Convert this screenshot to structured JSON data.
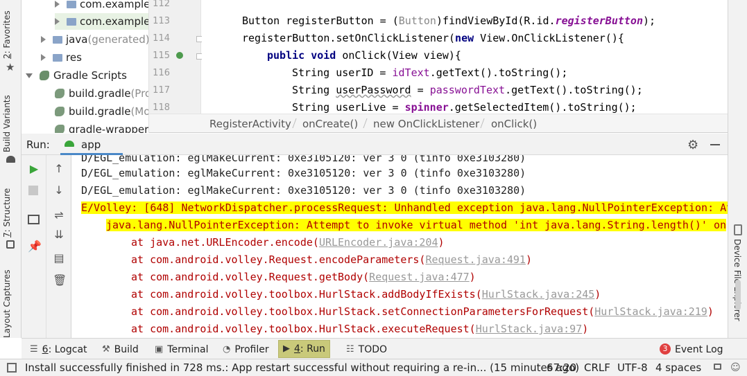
{
  "left_strip": {
    "favorites": {
      "num": "2",
      "label": ": Favorites"
    },
    "build_variants": "Build Variants",
    "structure": {
      "num": "7",
      "label": ": Structure"
    },
    "layout_captures": "Layout Captures"
  },
  "right_strip": {
    "device_explorer": "Device File Explorer"
  },
  "project_tree": [
    {
      "label": "com.example",
      "suffix": ""
    },
    {
      "label": "com.example",
      "suffix": ""
    },
    {
      "label": "java",
      "suffix": " (generated)"
    },
    {
      "label": "res",
      "suffix": ""
    },
    {
      "label": "Gradle Scripts",
      "suffix": ""
    },
    {
      "label": "build.gradle",
      "suffix": " (Pro"
    },
    {
      "label": "build.gradle",
      "suffix": " (Mo"
    },
    {
      "label": "gradle-wrapper.p",
      "suffix": ""
    }
  ],
  "editor": {
    "line_numbers": [
      "112",
      "113",
      "114",
      "115",
      "116",
      "117",
      "118"
    ],
    "lines": {
      "l113a": "Button registerButton = (",
      "l113b": "Button",
      "l113c": ")findViewById(R.id.",
      "l113d": "registerButton",
      "l113e": ");",
      "l114a": "registerButton.setOnClickListener(",
      "l114b": "new",
      "l114c": " View.OnClickListener(){",
      "l115a": "public",
      "l115b": " ",
      "l115c": "void",
      "l115d": " onClick(View view){",
      "l116a": "String userID = ",
      "l116b": "idText",
      "l116c": ".getText().toString();",
      "l117a": "String ",
      "l117b": "userPassword",
      "l117c": " = ",
      "l117d": "passwordText",
      "l117e": ".getText().toString();",
      "l118a": "String userLive = ",
      "l118b": "spinner",
      "l118c": ".getSelectedItem().toString();"
    }
  },
  "breadcrumb": [
    "RegisterActivity",
    "onCreate()",
    "new OnClickListener",
    "onClick()"
  ],
  "run_panel": {
    "run_label": "Run:",
    "tab_label": "app"
  },
  "console": {
    "line0": "D/EGL_emulation: eglMakeCurrent: 0xe3105120: ver 3 0 (tinfo 0xe3103280)",
    "line1": "D/EGL_emulation: eglMakeCurrent: 0xe3105120: ver 3 0 (tinfo 0xe3103280)",
    "line2": "D/EGL_emulation: eglMakeCurrent: 0xe3105120: ver 3 0 (tinfo 0xe3103280)",
    "error_head": "E/Volley: [648] NetworkDispatcher.processRequest: ",
    "error_tail": "Unhandled exception java.lang.NullPointerException: At",
    "npe_line": "java.lang.NullPointerException: Attempt to invoke virtual method 'int java.lang.String.length()' on",
    "stack": [
      {
        "text": "at java.net.URLEncoder.encode(",
        "link": "URLEncoder.java:204",
        "end": ")"
      },
      {
        "text": "at com.android.volley.Request.encodeParameters(",
        "link": "Request.java:491",
        "end": ")"
      },
      {
        "text": "at com.android.volley.Request.getBody(",
        "link": "Request.java:477",
        "end": ")"
      },
      {
        "text": "at com.android.volley.toolbox.HurlStack.addBodyIfExists(",
        "link": "HurlStack.java:245",
        "end": ")"
      },
      {
        "text": "at com.android.volley.toolbox.HurlStack.setConnectionParametersForRequest(",
        "link": "HurlStack.java:219",
        "end": ")"
      },
      {
        "text": "at com.android.volley.toolbox.HurlStack.executeRequest(",
        "link": "HurlStack.java:97",
        "end": ")"
      }
    ]
  },
  "bottom_tabs": {
    "logcat": {
      "num": "6",
      "label": ": Logcat"
    },
    "build": "Build",
    "terminal": "Terminal",
    "profiler": "Profiler",
    "run": {
      "num": "4",
      "label": ": Run"
    },
    "todo": "TODO",
    "event_log": "Event Log",
    "event_count": "3"
  },
  "status": {
    "message": "Install successfully finished in 728 ms.: App restart successful without requiring a re-in... (15 minutes ago)",
    "position": "67:20",
    "line_sep": "CRLF",
    "encoding": "UTF-8",
    "indent": "4 spaces"
  },
  "colors": {
    "highlight": "#ffff00",
    "error_text": "#b00000",
    "run_green": "#3aa53a",
    "event_badge": "#e04040"
  }
}
